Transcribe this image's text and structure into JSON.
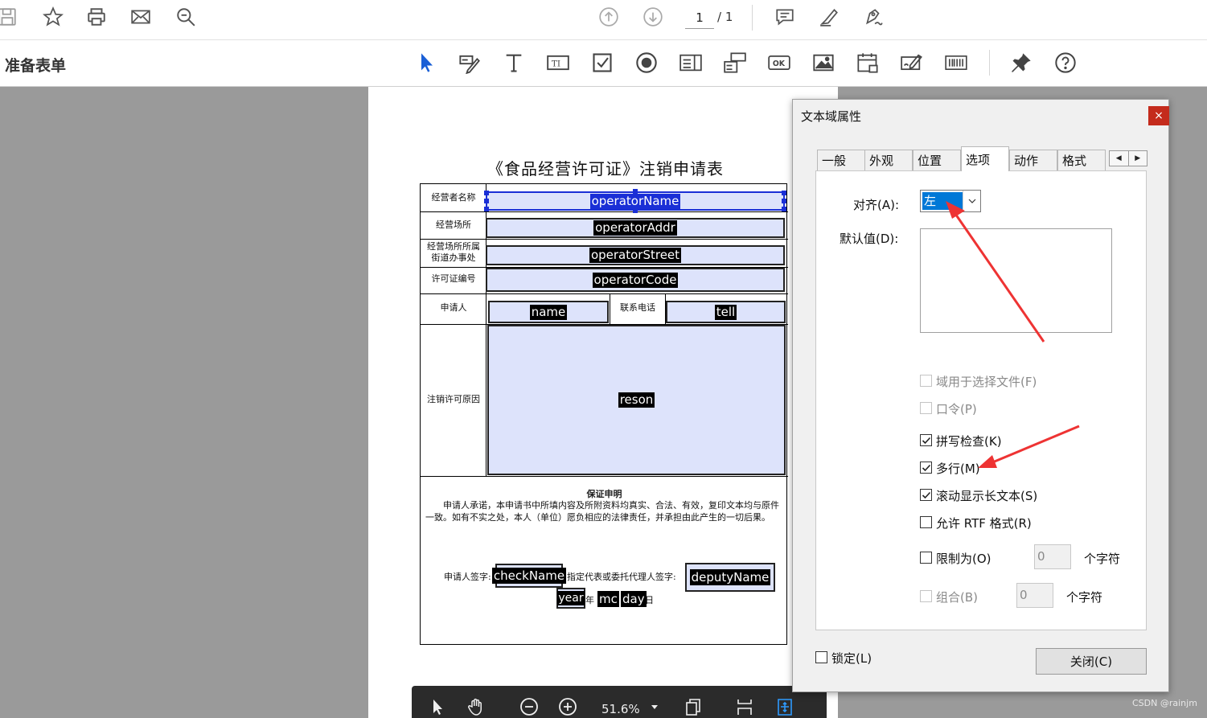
{
  "toolbar": {
    "page_current": "1",
    "page_total": "/ 1",
    "icons": [
      "save-icon",
      "star-icon",
      "print-icon",
      "mail-icon",
      "zoom-search-icon",
      "page-up-icon",
      "page-down-icon",
      "comment-icon",
      "highlight-icon",
      "sign-icon"
    ]
  },
  "formbar": {
    "title": "准备表单",
    "tools": [
      "select-arrow-icon",
      "edit-fields-icon",
      "text-icon",
      "text-field-icon",
      "checkbox-icon",
      "radio-icon",
      "list-box-icon",
      "dropdown-icon",
      "button-ok-icon",
      "image-icon",
      "date-icon",
      "signature-field-icon",
      "barcode-icon",
      "pin-icon",
      "help-icon"
    ]
  },
  "document": {
    "title": "《食品经营许可证》注销申请表",
    "labels": {
      "operator_name": "经营者名称",
      "operator_addr": "经营场所",
      "operator_street_1": "经营场所所属",
      "operator_street_2": "街道办事处",
      "operator_code": "许可证编号",
      "applicant": "申请人",
      "phone": "联系电话",
      "reason": "注销许可原因"
    },
    "fields": {
      "operatorName": "operatorName",
      "operatorAddr": "operatorAddr",
      "operatorStreet": "operatorStreet",
      "operatorCode": "operatorCode",
      "name": "name",
      "tell": "tell",
      "reson": "reson",
      "checkName": "checkName",
      "deputyName": "deputyName",
      "year": "year",
      "month": "mc",
      "day": "day"
    },
    "declaration_title": "保证申明",
    "declaration_body": "申请人承诺，本申请书中所填内容及所附资料均真实、合法、有效，复印文本均与原件一致。如有不实之处，本人（单位）愿负相应的法律责任，并承担由此产生的一切后果。",
    "applicant_sign_label": "申请人签字:",
    "deputy_sign_label": "指定代表或委托代理人签字:",
    "year_suffix": "年",
    "day_suffix": "日"
  },
  "bottombar": {
    "zoom": "51.6%"
  },
  "dialog": {
    "title": "文本域属性",
    "close_x": "×",
    "tabs": [
      "一般",
      "外观",
      "位置",
      "选项",
      "动作",
      "格式"
    ],
    "active_tab": "选项",
    "align_label": "对齐(A):",
    "align_value": "左",
    "default_label": "默认值(D):",
    "options": {
      "file_select": "域用于选择文件(F)",
      "password": "口令(P)",
      "spellcheck": "拼写检查(K)",
      "multiline": "多行(M)",
      "scroll_long": "滚动显示长文本(S)",
      "rtf": "允许 RTF 格式(R)",
      "limit": "限制为(O)",
      "comb": "组合(B)"
    },
    "limit_value": "0",
    "comb_value": "0",
    "chars_unit": "个字符",
    "lock_label": "锁定(L)",
    "close_button": "关闭(C)",
    "checked": {
      "file_select": false,
      "password": false,
      "spellcheck": true,
      "multiline": true,
      "scroll_long": true,
      "rtf": false,
      "limit": false,
      "comb": false,
      "lock": false
    }
  },
  "watermark": "CSDN @rainjm",
  "colors": {
    "field_fill": "#dde3fb",
    "selection_blue": "#1a2fd6",
    "annotation_red": "#ee3333",
    "close_red": "#c42b1c"
  }
}
